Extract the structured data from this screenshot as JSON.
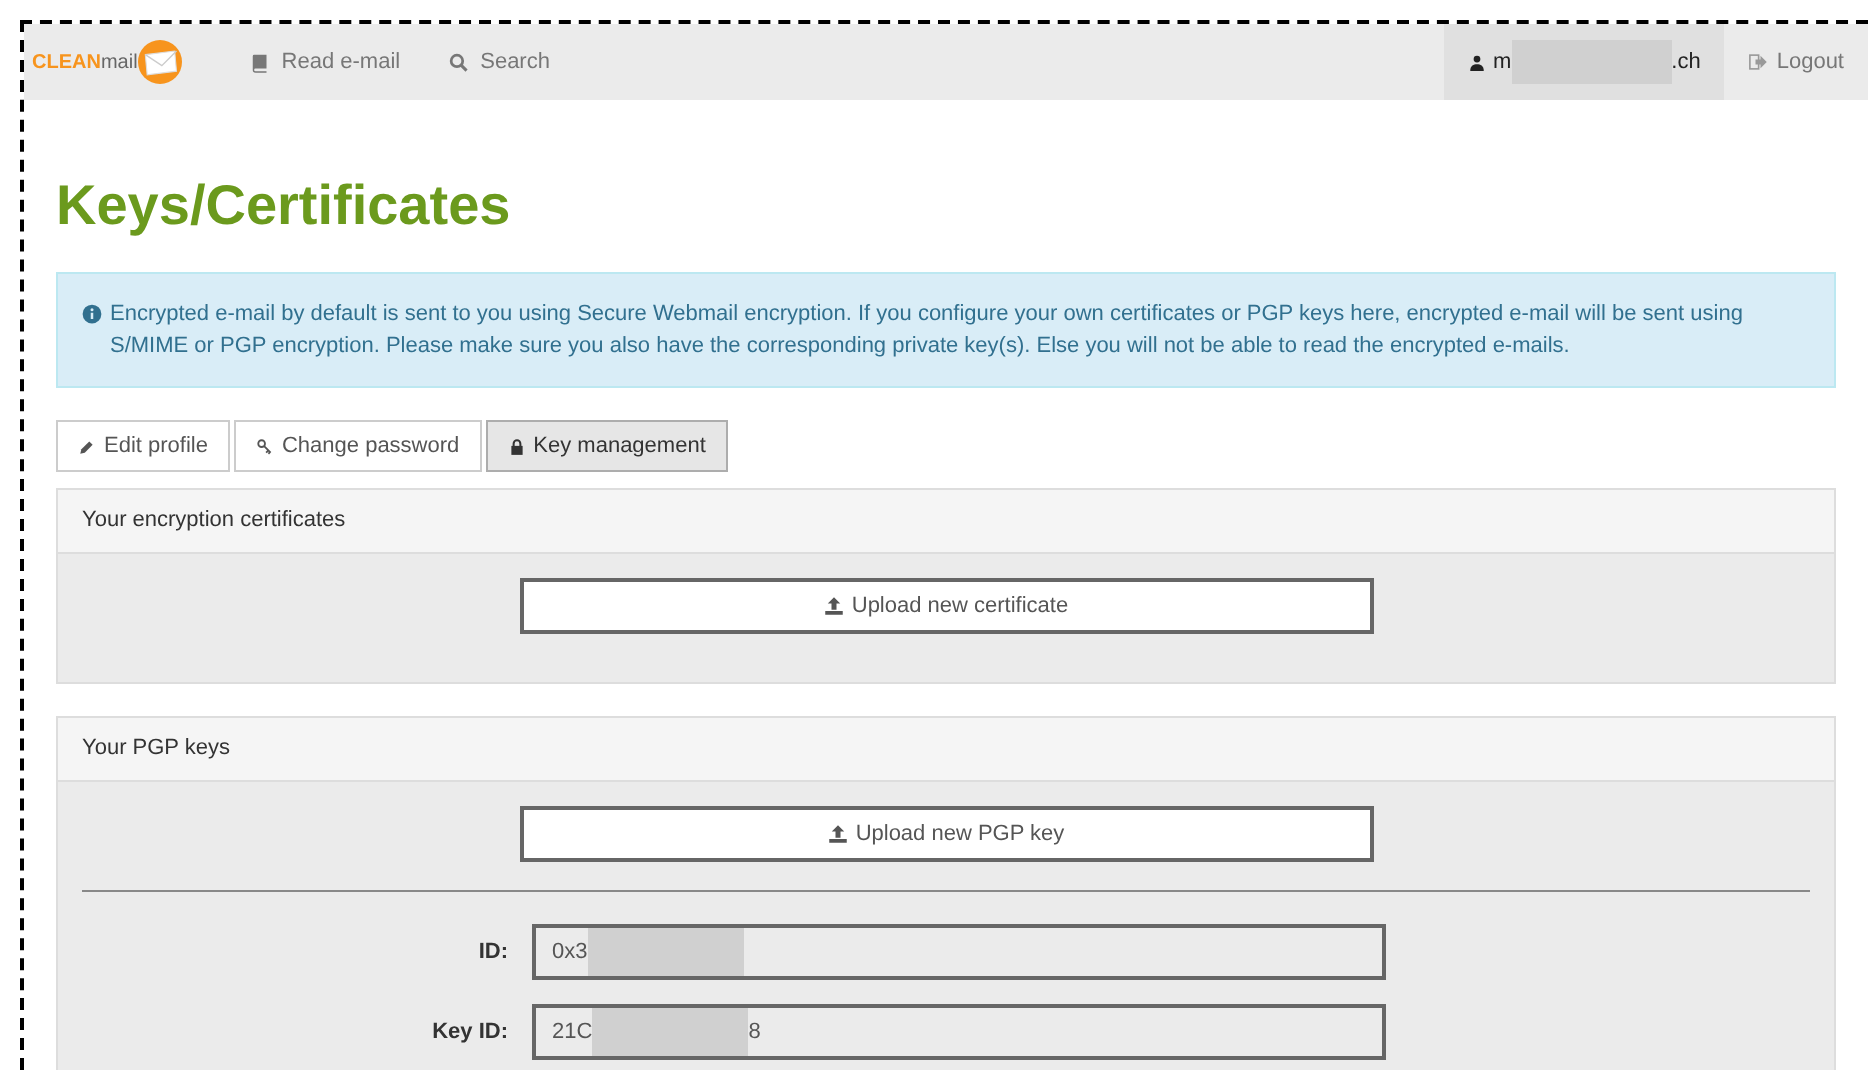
{
  "navbar": {
    "logo": {
      "strong": "CLEAN",
      "light": "mail"
    },
    "links": [
      {
        "label": "Read e-mail",
        "kind": "book"
      },
      {
        "label": "Search",
        "kind": "search"
      }
    ],
    "user": {
      "prefix": "m",
      "suffix": ".ch"
    },
    "logout": "Logout"
  },
  "title": "Keys/Certificates",
  "alert": "Encrypted e-mail by default is sent to you using Secure Webmail encryption. If you configure your own certificates or PGP keys here, encrypted e-mail will be sent using S/MIME or PGP encryption. Please make sure you also have the corresponding private key(s). Else you will not be able to read the encrypted e-mails.",
  "tabs": [
    {
      "label": "Edit profile",
      "kind": "pencil",
      "selected": false
    },
    {
      "label": "Change password",
      "kind": "key",
      "selected": false
    },
    {
      "label": "Key management",
      "kind": "lock",
      "selected": true
    }
  ],
  "panels": [
    {
      "heading": "Your encryption certificates",
      "button": "Upload new certificate"
    },
    {
      "heading": "Your PGP keys",
      "button": "Upload new PGP key",
      "fields": [
        {
          "label": "ID:",
          "prefix": "0x3"
        },
        {
          "label": "Key ID:",
          "prefix": "21C",
          "suffix": "8"
        }
      ]
    }
  ]
}
